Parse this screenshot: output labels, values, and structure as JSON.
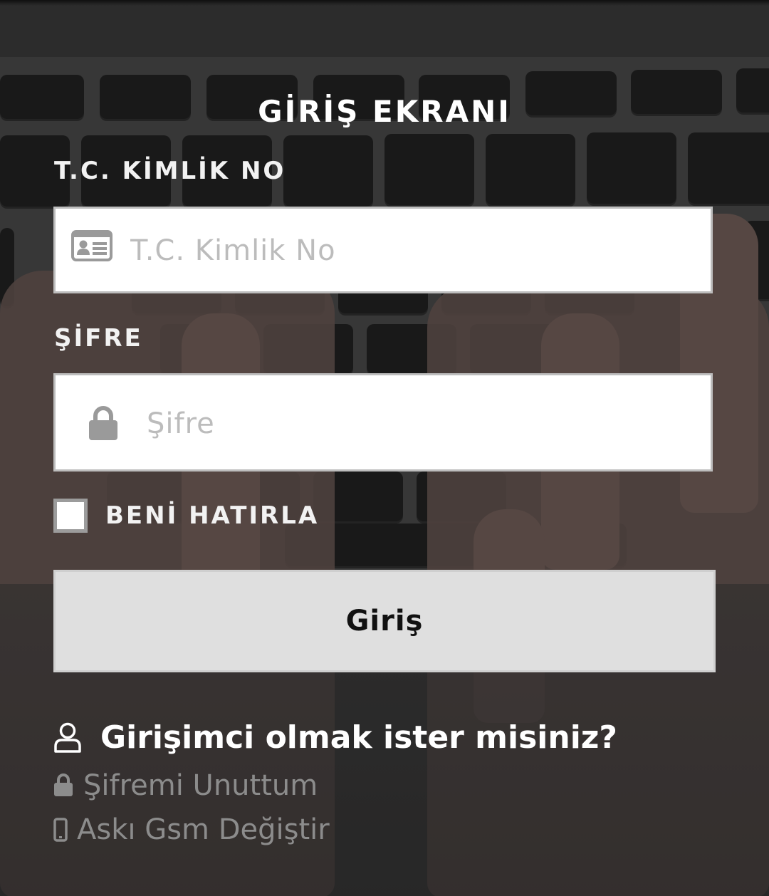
{
  "login": {
    "title": "GİRİŞ EKRANI",
    "tc_label": "T.C. KİMLİK NO",
    "tc_placeholder": "T.C. Kimlik No",
    "tc_value": "",
    "password_label": "ŞİFRE",
    "password_placeholder": "Şifre",
    "password_value": "",
    "remember_label": "BENİ HATIRLA",
    "remember_checked": false,
    "submit_label": "Giriş"
  },
  "links": {
    "entrepreneur": "Girişimci olmak ister misiniz?",
    "forgot_password": "Şifremi Unuttum",
    "change_gsm": "Askı Gsm Değiştir"
  },
  "icons": {
    "tc_field": "id-card-icon",
    "password_field": "lock-icon",
    "entrepreneur": "user-outline-icon",
    "forgot_password": "lock-icon",
    "change_gsm": "mobile-phone-icon"
  },
  "colors": {
    "background_overlay": "#2b2b2b",
    "text_primary": "#ffffff",
    "text_muted": "#8c8c8c",
    "input_bg": "#ffffff",
    "input_border": "#bdbdbd",
    "button_bg": "#dfdfdf",
    "checkbox_border": "#9c9c9c",
    "icon_gray": "#9a9a9a"
  }
}
